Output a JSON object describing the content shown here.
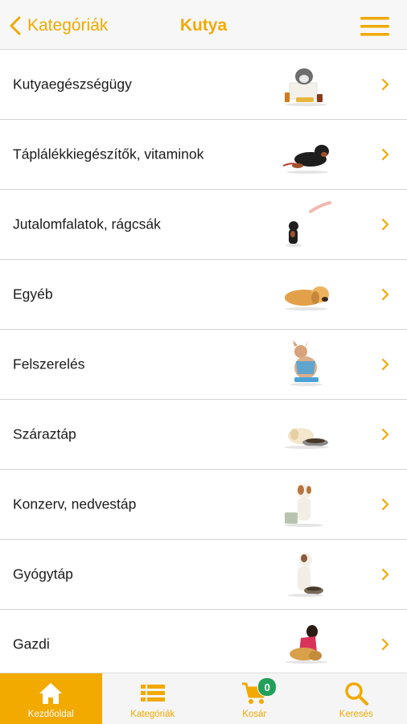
{
  "header": {
    "back_label": "Kategóriák",
    "title": "Kutya"
  },
  "categories": [
    {
      "label": "Kutyaegészségügy",
      "thumb": "dog-with-health-products"
    },
    {
      "label": "Táplálékkiegészítők, vitaminok",
      "thumb": "dachshund-lying"
    },
    {
      "label": "Jutalomfalatok, rágcsák",
      "thumb": "dachshund-with-treat"
    },
    {
      "label": "Egyéb",
      "thumb": "golden-retriever-puppy-lying"
    },
    {
      "label": "Felszerelés",
      "thumb": "chihuahua-with-harness"
    },
    {
      "label": "Száraztáp",
      "thumb": "puppy-at-food-bowl"
    },
    {
      "label": "Konzerv, nedvestáp",
      "thumb": "terrier-with-can"
    },
    {
      "label": "Gyógytáp",
      "thumb": "terrier-with-bowl"
    },
    {
      "label": "Gazdi",
      "thumb": "owner-hugging-dog"
    }
  ],
  "tabbar": {
    "tabs": [
      {
        "label": "Kezdőoldal",
        "icon": "home-icon",
        "active": true
      },
      {
        "label": "Kategóriák",
        "icon": "list-icon",
        "active": false
      },
      {
        "label": "Kosár",
        "icon": "cart-icon",
        "active": false
      },
      {
        "label": "Keresés",
        "icon": "search-icon",
        "active": false
      }
    ],
    "cart_count": "0"
  },
  "colors": {
    "accent": "#f2a900",
    "badge": "#22a05a",
    "header_bg": "#f7f7f7"
  }
}
